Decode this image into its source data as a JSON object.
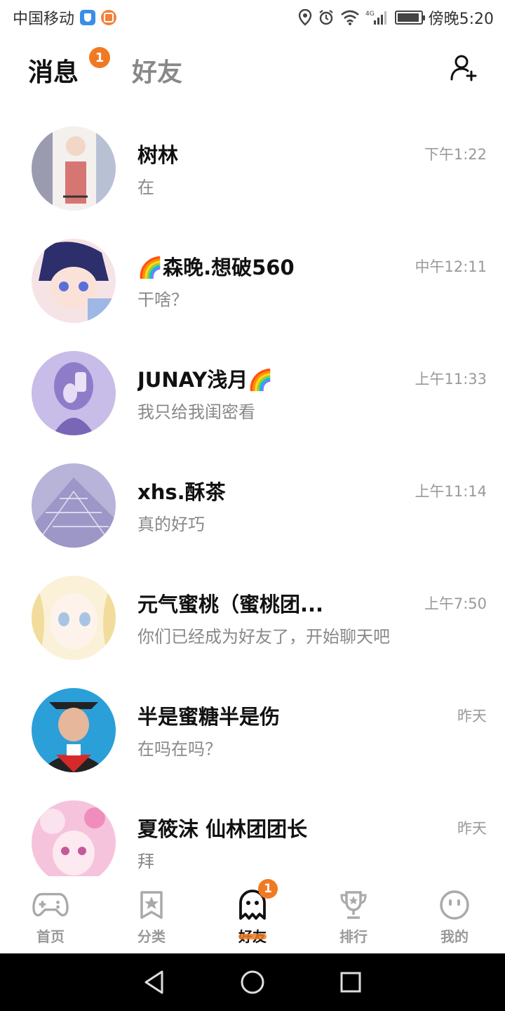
{
  "status_bar": {
    "carrier": "中国移动",
    "network": "4G",
    "time": "傍晚5:20",
    "battery_level": 0.95
  },
  "header": {
    "tabs": [
      {
        "label": "消息",
        "active": true,
        "badge": "1"
      },
      {
        "label": "好友",
        "active": false
      }
    ],
    "add_friend_icon": "add-user-icon"
  },
  "chats": [
    {
      "name": "树林",
      "preview": "在",
      "time": "下午1:22"
    },
    {
      "name": "🌈森晚.想破560",
      "preview": "干啥？",
      "time": "中午12:11"
    },
    {
      "name": "JUNAY浅月🌈",
      "preview": "我只给我闺密看",
      "time": "上午11:33"
    },
    {
      "name": "xhs.酥茶",
      "preview": "真的好巧",
      "time": "上午11:14"
    },
    {
      "name": "元气蜜桃（蜜桃团...",
      "preview": "你们已经成为好友了，开始聊天吧",
      "time": "上午7:50"
    },
    {
      "name": "半是蜜糖半是伤",
      "preview": "在吗在吗？",
      "time": "昨天"
    },
    {
      "name": "夏筱沫 仙林团团长",
      "preview": "拜",
      "time": "昨天"
    }
  ],
  "bottom_nav": [
    {
      "label": "首页",
      "icon": "gamepad-icon",
      "active": false
    },
    {
      "label": "分类",
      "icon": "star-bookmark-icon",
      "active": false
    },
    {
      "label": "好友",
      "icon": "ghost-icon",
      "active": true,
      "badge": "1"
    },
    {
      "label": "排行",
      "icon": "trophy-icon",
      "active": false
    },
    {
      "label": "我的",
      "icon": "face-icon",
      "active": false
    }
  ],
  "colors": {
    "accent": "#f07a23",
    "text_primary": "#111111",
    "text_secondary": "#888888"
  }
}
